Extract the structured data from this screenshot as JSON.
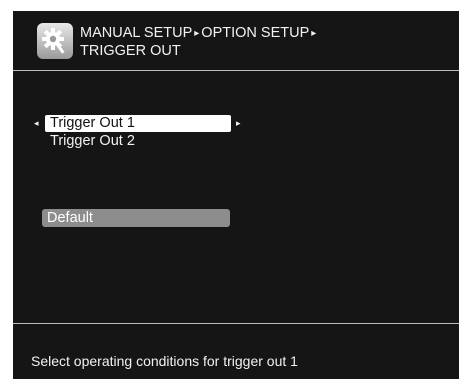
{
  "header": {
    "icon": "gear-wrench-icon",
    "breadcrumb": [
      "MANUAL SETUP",
      "OPTION SETUP",
      "TRIGGER OUT"
    ],
    "separator": "▸"
  },
  "menu": {
    "items": [
      {
        "label": "Trigger Out 1",
        "selected": true
      },
      {
        "label": "Trigger Out 2",
        "selected": false
      }
    ],
    "left_arrow": "◂",
    "right_arrow": "▸"
  },
  "default_button": "Default",
  "status_text": "Select operating conditions for trigger out 1",
  "colors": {
    "background": "#151515",
    "text": "#f2f2f2",
    "highlight": "#ffffff",
    "button": "#8d8d8d",
    "rule": "#bdbdbd"
  }
}
